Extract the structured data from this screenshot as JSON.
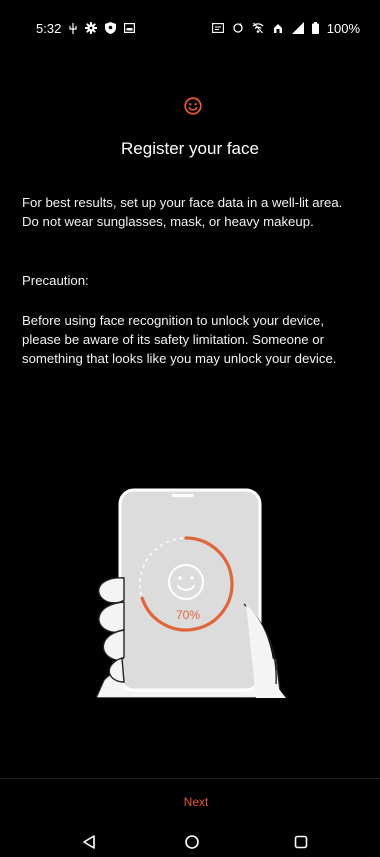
{
  "status_bar": {
    "time": "5:32",
    "battery_percent": "100%",
    "left_icons": [
      "usb-debug-icon",
      "settings-gear-icon",
      "shield-icon",
      "screenshot-icon"
    ],
    "right_icons": [
      "sim-card-icon",
      "sync-icon",
      "wifi-off-icon",
      "data-saver-icon",
      "signal-icon",
      "battery-icon"
    ]
  },
  "header": {
    "icon": "smiley-face-icon",
    "title": "Register your face"
  },
  "instructions": {
    "best_results": "For best results, set up your face data in a well-lit area. Do not wear sunglasses, mask, or heavy makeup.",
    "precaution_label": "Precaution:",
    "precaution_text": "Before using face recognition to unlock your device, please be aware of its safety limitation. Someone or something that looks like you may unlock your device."
  },
  "illustration": {
    "progress_label": "70%",
    "progress_fraction": 0.7,
    "accent_color": "#e0653b"
  },
  "footer": {
    "next_label": "Next"
  },
  "navigation_bar": {
    "icons": [
      "back-icon",
      "home-icon",
      "recents-icon"
    ]
  },
  "colors": {
    "background": "#000000",
    "accent": "#e4572e",
    "text": "#ffffff"
  }
}
